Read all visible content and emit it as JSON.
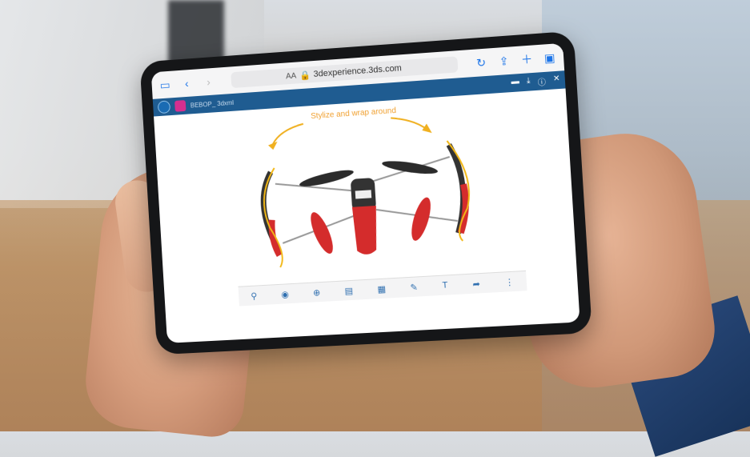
{
  "browser": {
    "url": "3dexperience.3ds.com",
    "text_size_label": "AA",
    "icons": [
      "sidebar-icon",
      "back-icon",
      "forward-icon",
      "lock-icon",
      "reader-icon",
      "reload-icon",
      "share-icon",
      "new-tab-icon",
      "tabs-icon"
    ]
  },
  "app": {
    "title": "BEBOP_ 3dxml",
    "header_icons": [
      "compass-icon",
      "app-logo-icon",
      "chat-icon",
      "download-icon",
      "info-icon",
      "close-icon"
    ]
  },
  "canvas": {
    "annotation": "Stylize and wrap around"
  },
  "toolbar": {
    "icons": [
      "search-icon",
      "view-icon",
      "zoom-icon",
      "section-icon",
      "measure-icon",
      "pen-icon",
      "text-icon",
      "share-arrow-icon",
      "more-icon"
    ]
  },
  "colors": {
    "app_bar": "#1f5c91",
    "annotation": "#f0a030",
    "drone_red": "#d42c2c"
  }
}
